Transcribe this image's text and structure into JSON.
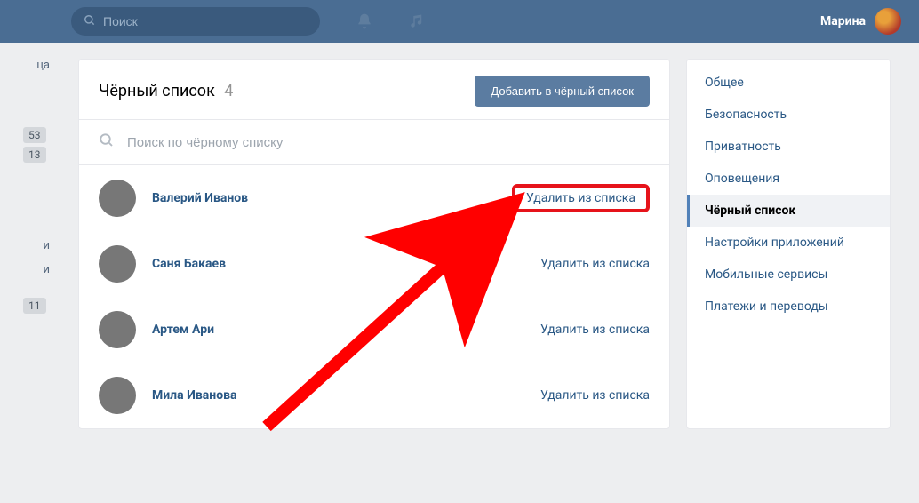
{
  "top": {
    "search_placeholder": "Поиск",
    "username": "Марина"
  },
  "left_partial": {
    "label1": "ца",
    "badge1": "53",
    "badge2": "13",
    "label2": "и",
    "label3": "и",
    "badge3": "11"
  },
  "main": {
    "title": "Чёрный список",
    "count": "4",
    "add_button": "Добавить в чёрный список",
    "list_search_placeholder": "Поиск по чёрному списку",
    "remove_label": "Удалить из списка",
    "people": [
      {
        "name": "Валерий Иванов"
      },
      {
        "name": "Саня Бакаев"
      },
      {
        "name": "Артем Ари"
      },
      {
        "name": "Мила Иванова"
      }
    ]
  },
  "sidebar": {
    "items": [
      {
        "label": "Общее"
      },
      {
        "label": "Безопасность"
      },
      {
        "label": "Приватность"
      },
      {
        "label": "Оповещения"
      },
      {
        "label": "Чёрный список",
        "active": true
      },
      {
        "label": "Настройки приложений"
      },
      {
        "label": "Мобильные сервисы"
      },
      {
        "label": "Платежи и переводы"
      }
    ]
  }
}
